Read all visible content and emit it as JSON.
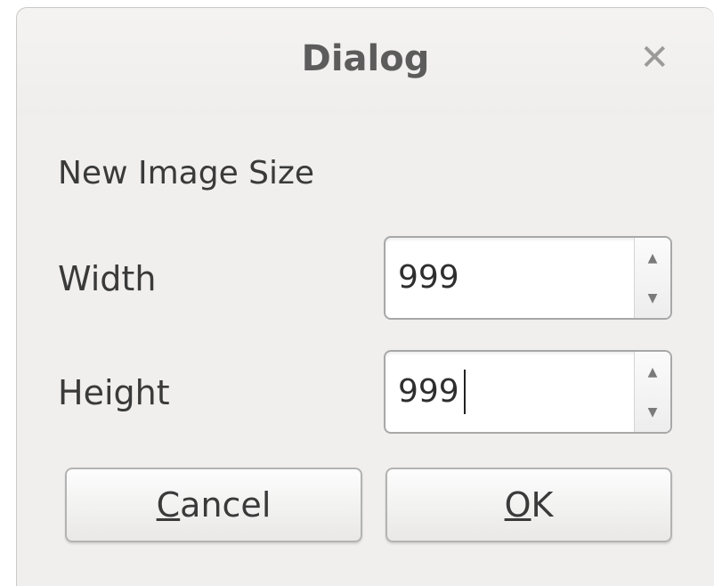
{
  "window": {
    "title": "Dialog",
    "close_glyph": "✕"
  },
  "form": {
    "section_label": "New Image Size",
    "width": {
      "label": "Width",
      "value": "999"
    },
    "height": {
      "label": "Height",
      "value": "999"
    }
  },
  "buttons": {
    "cancel": {
      "mnemonic": "C",
      "rest": "ancel"
    },
    "ok": {
      "mnemonic": "O",
      "rest": "K"
    }
  },
  "icons": {
    "close": "close-icon",
    "spin_up": "chevron-up-icon",
    "spin_down": "chevron-down-icon"
  },
  "colors": {
    "dialog_bg": "#f0efee",
    "title_text": "#5c5c5c",
    "field_border": "#a8a8a8"
  }
}
